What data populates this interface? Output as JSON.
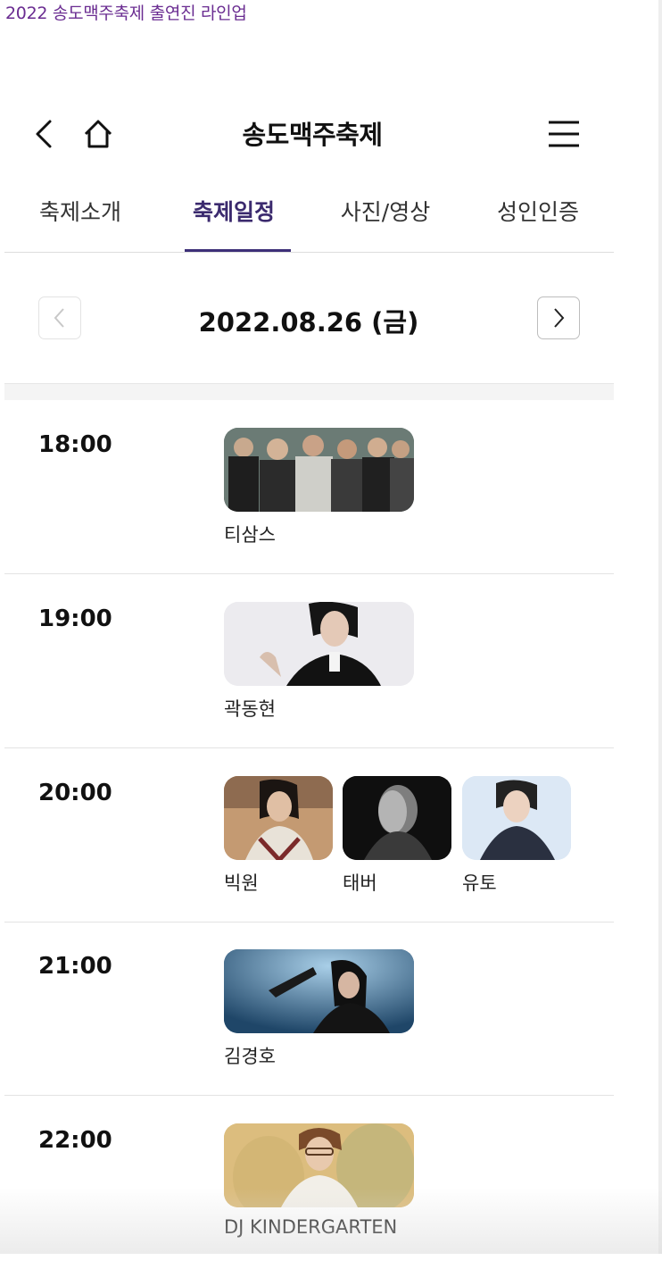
{
  "page_caption": "2022 송도맥주축제 출연진 라인업",
  "header": {
    "title": "송도맥주축제",
    "back_icon": "chevron-left-icon",
    "home_icon": "home-icon",
    "menu_icon": "hamburger-menu-icon"
  },
  "tabs": [
    {
      "label": "축제소개",
      "active": false
    },
    {
      "label": "축제일정",
      "active": true
    },
    {
      "label": "사진/영상",
      "active": false
    },
    {
      "label": "성인인증",
      "active": false
    }
  ],
  "date_nav": {
    "date": "2022.08.26 (금)",
    "prev_icon": "chevron-left-icon",
    "next_icon": "chevron-right-icon"
  },
  "schedule": [
    {
      "time": "18:00",
      "performers": [
        {
          "name": "티삼스"
        }
      ]
    },
    {
      "time": "19:00",
      "performers": [
        {
          "name": "곽동현"
        }
      ]
    },
    {
      "time": "20:00",
      "performers": [
        {
          "name": "빅원"
        },
        {
          "name": "태버"
        },
        {
          "name": "유토"
        }
      ]
    },
    {
      "time": "21:00",
      "performers": [
        {
          "name": "김경호"
        }
      ]
    },
    {
      "time": "22:00",
      "performers": [
        {
          "name": "DJ KINDERGARTEN"
        }
      ]
    }
  ],
  "colors": {
    "accent": "#3d2f78",
    "caption": "#6a2c91"
  }
}
